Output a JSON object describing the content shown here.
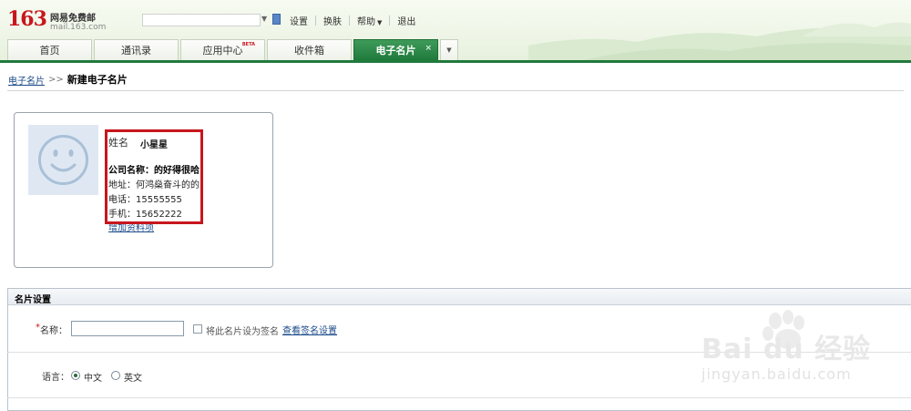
{
  "logo": {
    "number": "163",
    "name": "网易免费邮",
    "domain": "mail.163.com"
  },
  "topnav": {
    "settings": "设置",
    "skin": "换肤",
    "help": "帮助",
    "logout": "退出"
  },
  "tabs": [
    {
      "label": "首页"
    },
    {
      "label": "通讯录"
    },
    {
      "label": "应用中心",
      "badge": "BETA"
    },
    {
      "label": "收件箱"
    },
    {
      "label": "电子名片",
      "active": true,
      "close": "×"
    }
  ],
  "breadcrumb": {
    "link": "电子名片",
    "separator": ">>",
    "current": "新建电子名片"
  },
  "card": {
    "name_label": "姓名",
    "name_value": "小星星",
    "company": "公司名称：的好得很哈",
    "address": "地址：何鸿燊奋斗的的",
    "phone": "电话：15555555",
    "mobile": "手机：15652222",
    "add_more": "增加资料项"
  },
  "settings": {
    "title": "名片设置",
    "required_mark": "*",
    "name_label": "名称：",
    "name_value": "",
    "signature_checkbox_label": "将此名片设为签名",
    "view_signature_link": "查看签名设置",
    "language_label": "语言：",
    "language_options": [
      "中文",
      "英文"
    ],
    "language_selected": "中文"
  },
  "watermark": {
    "text": "Bai du 经验",
    "url": "jingyan.baidu.com"
  },
  "colors": {
    "brand_red": "#c8161d",
    "tab_green": "#1f7a3c",
    "link_blue": "#1a4a8a",
    "highlight_red": "#c8161d"
  }
}
